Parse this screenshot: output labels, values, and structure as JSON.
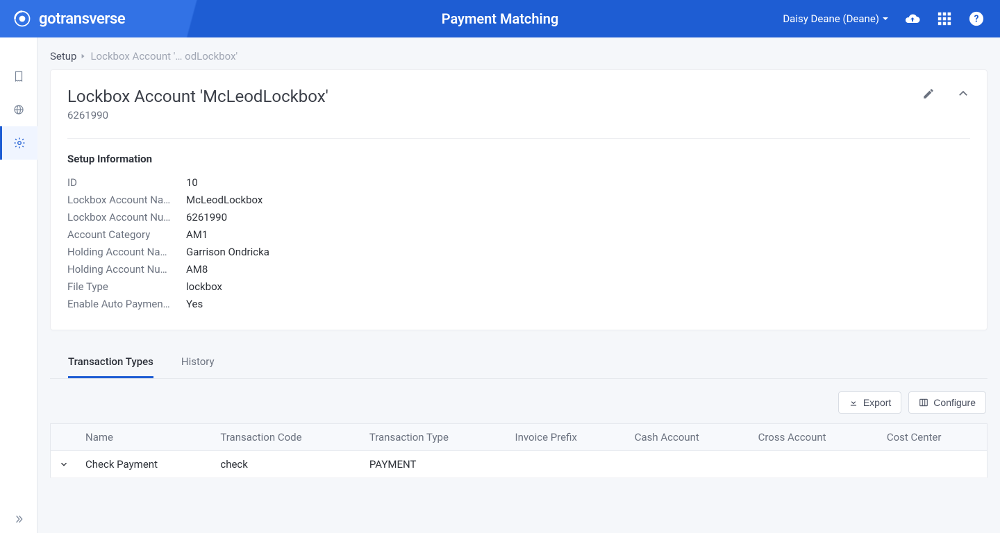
{
  "brand": "gotransverse",
  "app_title": "Payment Matching",
  "user": {
    "display": "Daisy Deane (Deane)"
  },
  "breadcrumb": {
    "root": "Setup",
    "current": "Lockbox Account '… odLockbox'"
  },
  "page": {
    "title": "Lockbox Account 'McLeodLockbox'",
    "subtitle": "6261990"
  },
  "setup_info": {
    "section_label": "Setup Information",
    "rows": [
      {
        "label": "ID",
        "value": "10"
      },
      {
        "label": "Lockbox Account Na…",
        "value": "McLeodLockbox"
      },
      {
        "label": "Lockbox Account Nu…",
        "value": "6261990"
      },
      {
        "label": "Account Category",
        "value": "AM1"
      },
      {
        "label": "Holding Account Na…",
        "value": "Garrison Ondricka"
      },
      {
        "label": "Holding Account Nu…",
        "value": "AM8"
      },
      {
        "label": "File Type",
        "value": "lockbox"
      },
      {
        "label": "Enable Auto Paymen…",
        "value": "Yes"
      }
    ]
  },
  "tabs": [
    {
      "label": "Transaction Types",
      "active": true
    },
    {
      "label": "History",
      "active": false
    }
  ],
  "toolbar": {
    "export_label": "Export",
    "configure_label": "Configure"
  },
  "table": {
    "headers": [
      "Name",
      "Transaction Code",
      "Transaction Type",
      "Invoice Prefix",
      "Cash Account",
      "Cross Account",
      "Cost Center"
    ],
    "rows": [
      {
        "name": "Check Payment",
        "code": "check",
        "type": "PAYMENT",
        "invoice_prefix": "",
        "cash_account": "",
        "cross_account": "",
        "cost_center": ""
      }
    ]
  }
}
